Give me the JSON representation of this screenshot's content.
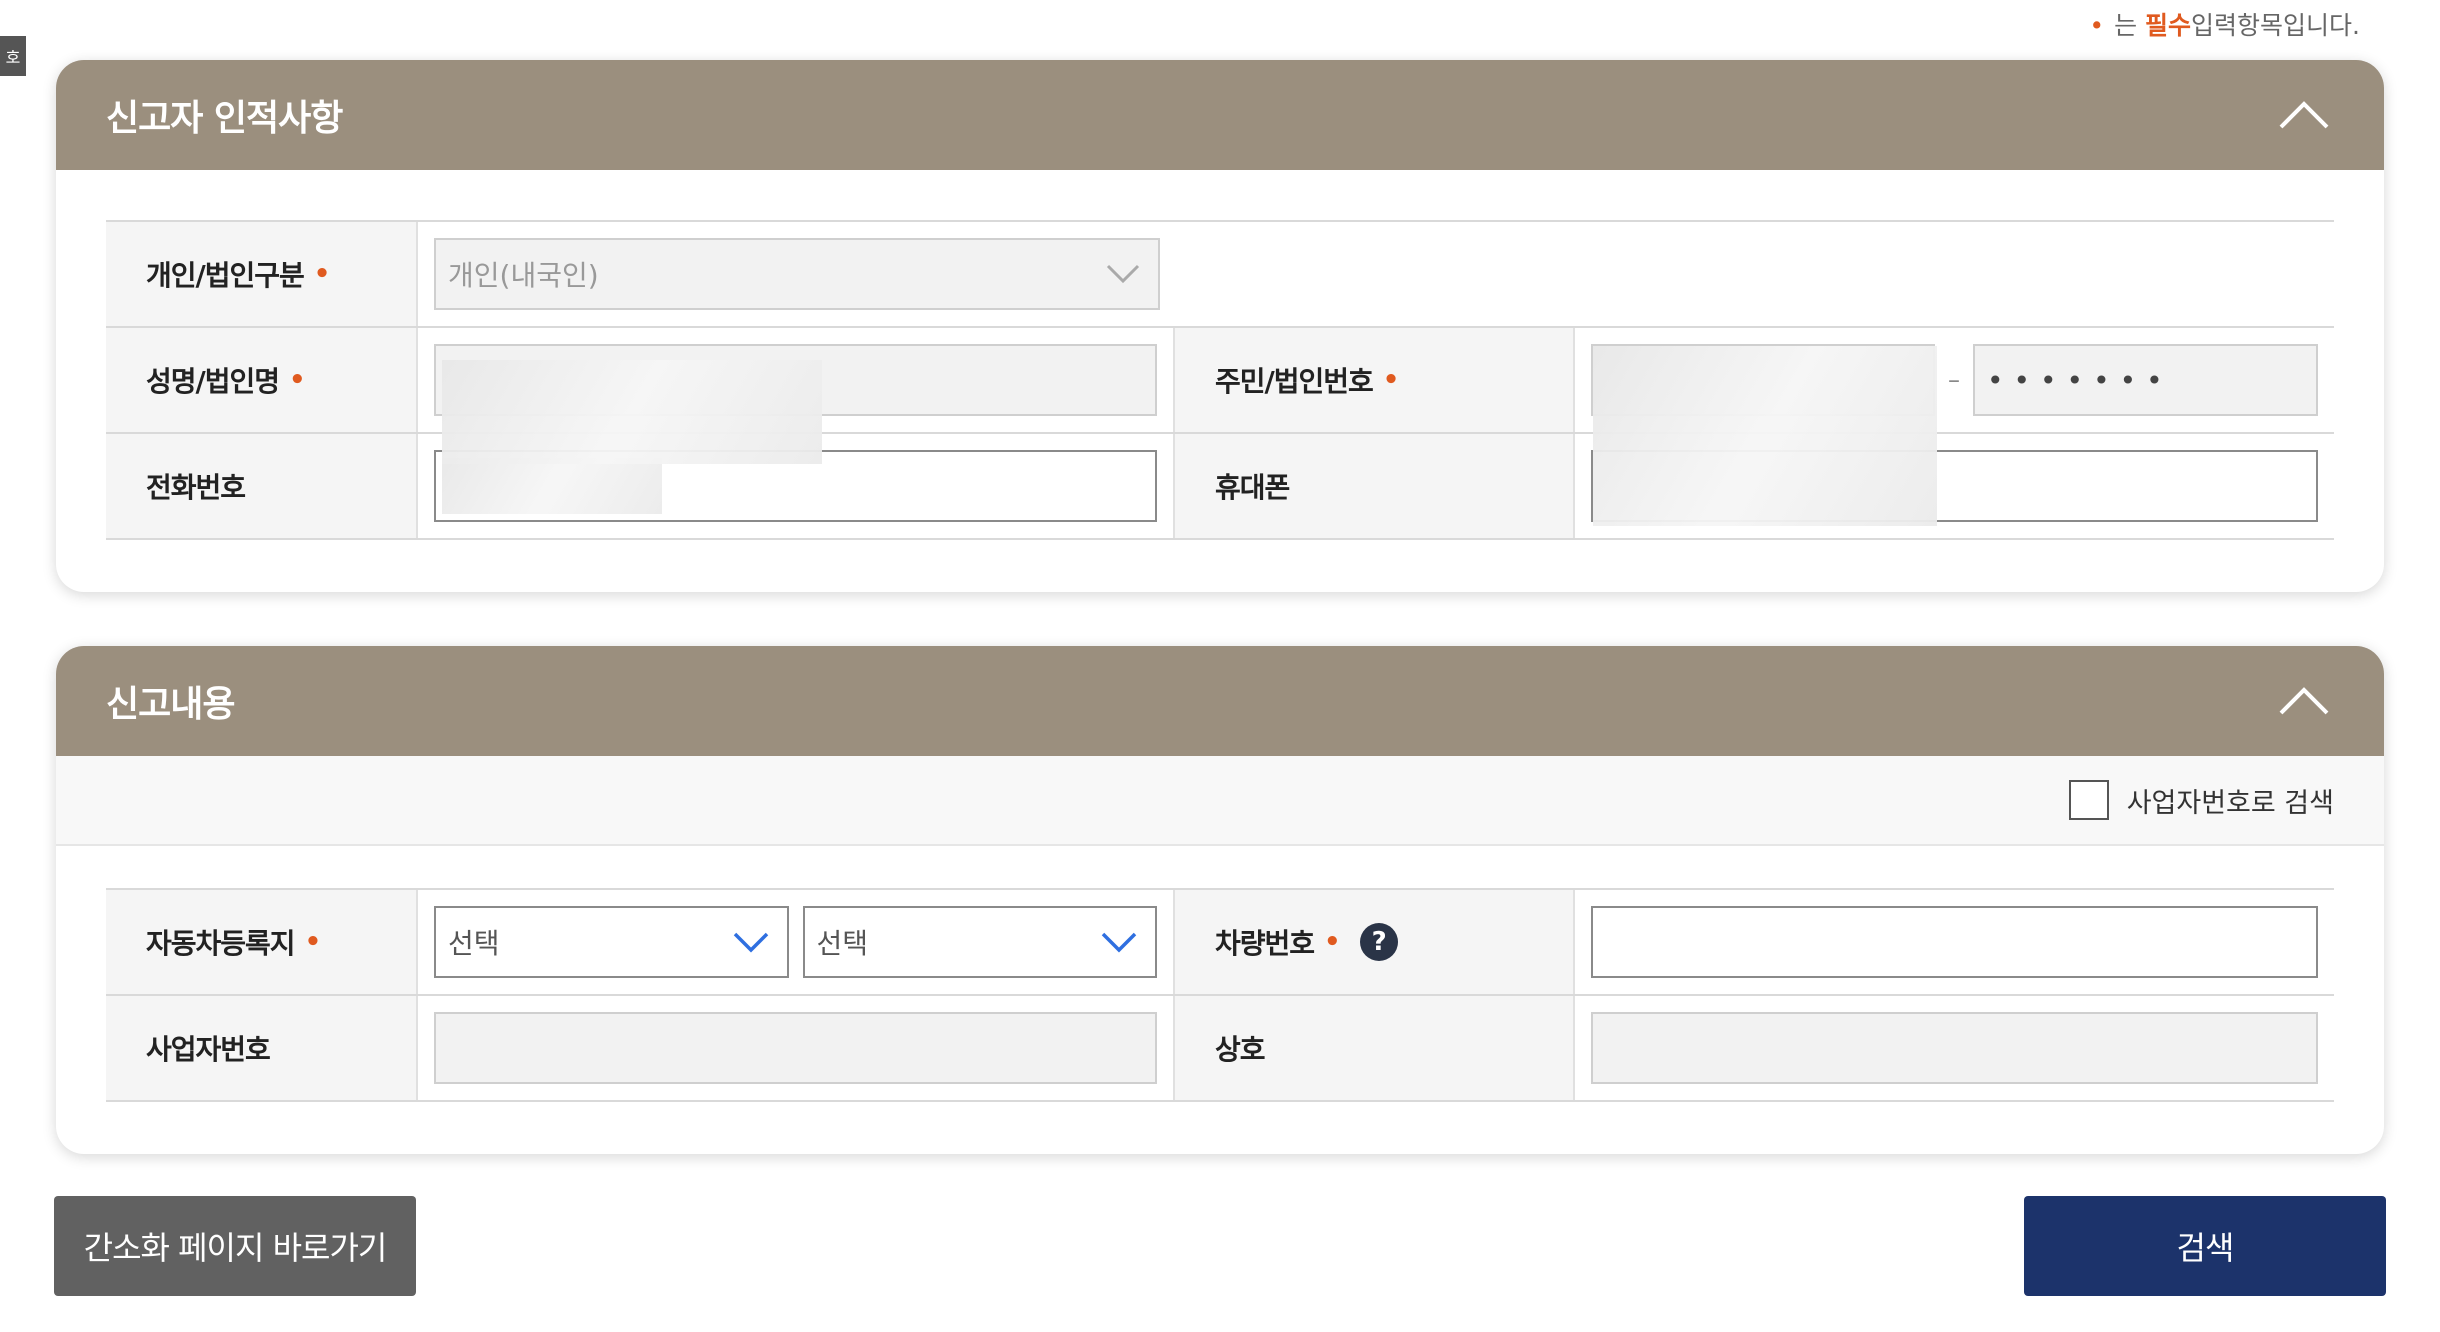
{
  "side_tab": {
    "label": "호"
  },
  "required_note": {
    "dot": "•",
    "prefix": "는",
    "required_word": "필수",
    "suffix": "입력항목입니다."
  },
  "section1": {
    "title": "신고자 인적사항",
    "rows": {
      "type": {
        "label": "개인/법인구분",
        "required_mark": "•",
        "selected": "개인(내국인)"
      },
      "name": {
        "label": "성명/법인명",
        "required_mark": "•"
      },
      "id": {
        "label": "주민/법인번호",
        "required_mark": "•",
        "masked_back": "•••••••",
        "separator": "–"
      },
      "phone": {
        "label": "전화번호"
      },
      "mobile": {
        "label": "휴대폰"
      }
    }
  },
  "section2": {
    "title": "신고내용",
    "checkbox_label": "사업자번호로 검색",
    "rows": {
      "region": {
        "label": "자동차등록지",
        "required_mark": "•",
        "select1": "선택",
        "select2": "선택"
      },
      "car_no": {
        "label": "차량번호",
        "required_mark": "•",
        "help": "?"
      },
      "biz_no": {
        "label": "사업자번호"
      },
      "company": {
        "label": "상호"
      }
    }
  },
  "buttons": {
    "simple": "간소화 페이지 바로가기",
    "search": "검색"
  },
  "colors": {
    "header_bg": "#9b8f7e",
    "required_dot": "#e05a1f",
    "primary_button": "#1c336b",
    "secondary_button": "#616161",
    "select_chevron_active": "#2f6fe0"
  },
  "icons": {
    "collapse": "chevron-up-icon",
    "select": "chevron-down-icon",
    "help": "question-circle-icon"
  }
}
